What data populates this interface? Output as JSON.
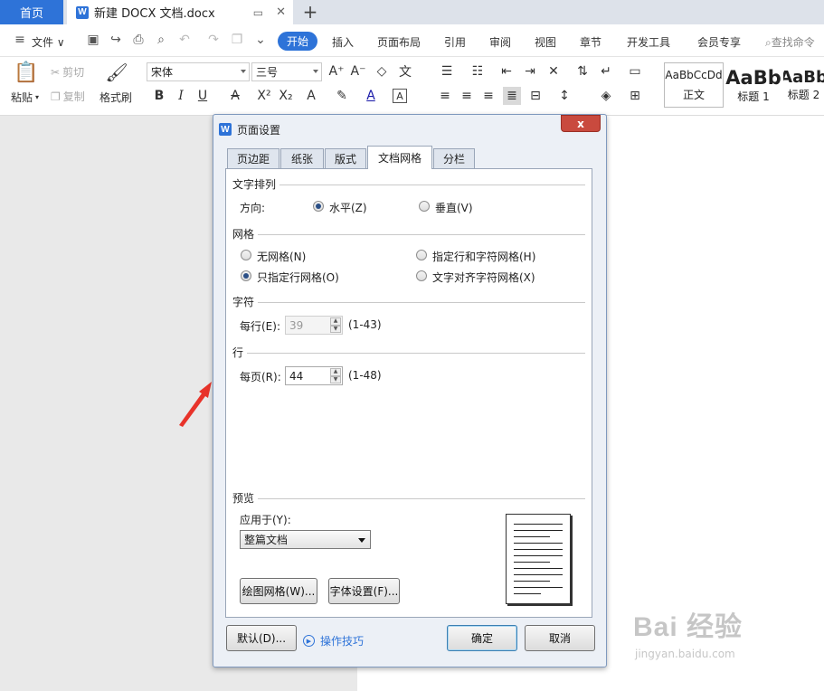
{
  "tabs": {
    "home": "首页",
    "doc": "新建 DOCX 文档.docx",
    "add": "+"
  },
  "menu": {
    "file": "文件",
    "items": [
      "开始",
      "插入",
      "页面布局",
      "引用",
      "审阅",
      "视图",
      "章节",
      "开发工具",
      "会员专享"
    ],
    "search": "查找命令"
  },
  "ribbon": {
    "paste": "粘贴",
    "cut": "剪切",
    "copy": "复制",
    "format_painter": "格式刷",
    "font_name": "宋体",
    "font_size": "三号",
    "styles": [
      {
        "sample": "AaBbCcDd",
        "name": "正文"
      },
      {
        "sample": "AaBb",
        "name": "标题 1"
      },
      {
        "sample": "AaBb",
        "name": "标题 2"
      }
    ]
  },
  "dialog": {
    "title": "页面设置",
    "close": "x",
    "tabs": [
      "页边距",
      "纸张",
      "版式",
      "文档网格",
      "分栏"
    ],
    "active_tab": "文档网格",
    "text_direction": {
      "section": "文字排列",
      "label": "方向:",
      "horizontal": "水平(Z)",
      "vertical": "垂直(V)",
      "selected": "水平(Z)"
    },
    "grid": {
      "section": "网格",
      "none": "无网格(N)",
      "rows_chars": "指定行和字符网格(H)",
      "rows_only": "只指定行网格(O)",
      "align_chars": "文字对齐字符网格(X)",
      "selected": "只指定行网格(O)"
    },
    "chars": {
      "section": "字符",
      "label": "每行(E):",
      "value": "39",
      "range": "(1-43)"
    },
    "lines": {
      "section": "行",
      "label": "每页(R):",
      "value": "44",
      "range": "(1-48)"
    },
    "preview": {
      "section": "预览",
      "apply_label": "应用于(Y):",
      "apply_value": "整篇文档"
    },
    "buttons": {
      "draw_grid": "绘图网格(W)...",
      "font_settings": "字体设置(F)...",
      "default": "默认(D)...",
      "tips": "操作技巧",
      "ok": "确定",
      "cancel": "取消"
    }
  },
  "watermark": {
    "brand": "Bai 经验",
    "url": "jingyan.baidu.com"
  },
  "colors": {
    "accent": "#2e73d8",
    "close": "#c94a3e",
    "arrow": "#e8332a"
  }
}
